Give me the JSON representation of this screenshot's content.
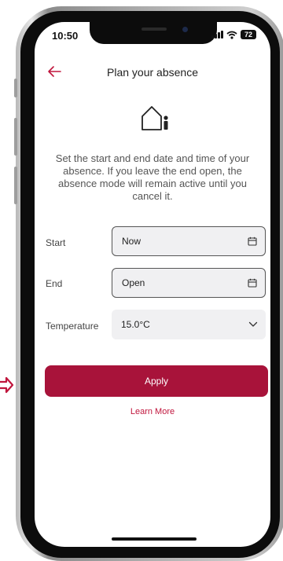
{
  "status_bar": {
    "time": "10:50",
    "battery": "72",
    "icons": [
      "signal-icon",
      "wifi-icon",
      "battery-icon"
    ]
  },
  "header": {
    "back_icon": "arrow-left-icon",
    "title": "Plan your absence"
  },
  "illustration": {
    "icon": "house-person-icon"
  },
  "description": "Set the start and end date and time of your absence. If you leave the end open, the absence mode will remain active until you cancel it.",
  "form": {
    "start": {
      "label": "Start",
      "value": "Now",
      "icon": "calendar-icon"
    },
    "end": {
      "label": "End",
      "value": "Open",
      "icon": "calendar-icon"
    },
    "temperature": {
      "label": "Temperature",
      "value": "15.0°C",
      "icon": "chevron-down-icon"
    }
  },
  "actions": {
    "apply_label": "Apply",
    "learn_more_label": "Learn More"
  },
  "colors": {
    "accent": "#a8133a",
    "link": "#c0163d",
    "field_bg": "#f0f0f2"
  }
}
